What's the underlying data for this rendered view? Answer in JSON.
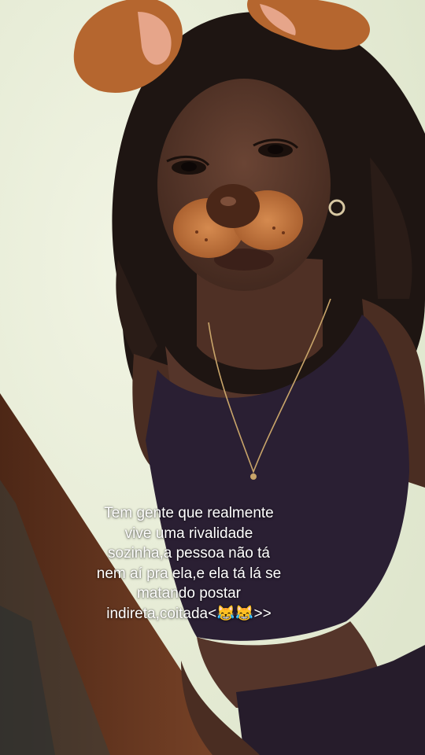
{
  "story": {
    "caption_lines": [
      "Tem gente que realmente",
      "vive uma rivalidade",
      "sozinha,a pessoa não tá",
      "nem aí pra ela,e ela tá lá se",
      "matando postar",
      "indireta,coitada<😹😹>>"
    ]
  },
  "colors": {
    "wall": "#e6ecd6",
    "door": "#6e3b22",
    "top": "#2a1f33",
    "skin": "#5b3a2e",
    "hair": "#1e1512",
    "filter_fur": "#b5662f"
  }
}
